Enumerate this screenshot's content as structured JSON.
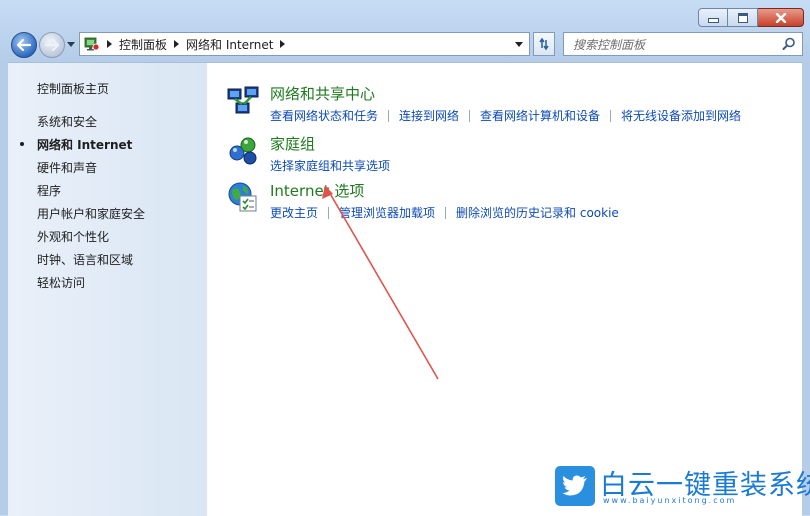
{
  "window": {
    "caption_icons": [
      "minimize-icon",
      "maximize-icon",
      "close-icon"
    ]
  },
  "address": {
    "crumbs": [
      "控制面板",
      "网络和 Internet"
    ]
  },
  "search": {
    "placeholder": "搜索控制面板"
  },
  "sidebar": {
    "home": "控制面板主页",
    "items": [
      {
        "label": "系统和安全",
        "current": false
      },
      {
        "label": "网络和 Internet",
        "current": true
      },
      {
        "label": "硬件和声音",
        "current": false
      },
      {
        "label": "程序",
        "current": false
      },
      {
        "label": "用户帐户和家庭安全",
        "current": false
      },
      {
        "label": "外观和个性化",
        "current": false
      },
      {
        "label": "时钟、语言和区域",
        "current": false
      },
      {
        "label": "轻松访问",
        "current": false
      }
    ]
  },
  "categories": [
    {
      "title": "网络和共享中心",
      "icon": "network-center-icon",
      "links": [
        "查看网络状态和任务",
        "连接到网络",
        "查看网络计算机和设备",
        "将无线设备添加到网络"
      ]
    },
    {
      "title": "家庭组",
      "icon": "homegroup-icon",
      "links": [
        "选择家庭组和共享选项"
      ]
    },
    {
      "title": "Internet 选项",
      "icon": "internet-options-icon",
      "links": [
        "更改主页",
        "管理浏览器加载项",
        "删除浏览的历史记录和 cookie"
      ]
    }
  ],
  "watermark": {
    "name": "白云一键重装系统",
    "url": "www.baiyunxitong.com"
  },
  "colors": {
    "link": "#0d4bb8",
    "category_title": "#1f7a1f",
    "annotation_arrow": "#e0534a"
  }
}
